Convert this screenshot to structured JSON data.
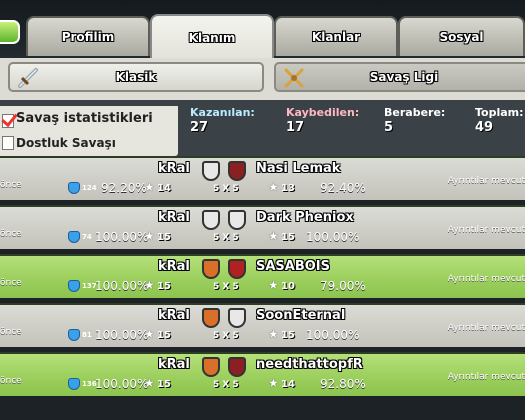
{
  "tabs": [
    {
      "label": "Profilim"
    },
    {
      "label": "Klanım"
    },
    {
      "label": "Klanlar"
    },
    {
      "label": "Sosyal"
    }
  ],
  "modes": {
    "classic": "Klasik",
    "league": "Savaş Ligi"
  },
  "stats": {
    "title": "Savaş istatistikleri",
    "friendly": "Dostluk Savaşı",
    "won_label": "Kazanılan:",
    "won": "27",
    "lost_label": "Kaybedilen:",
    "lost": "17",
    "draw_label": "Berabere:",
    "draw": "5",
    "total_label": "Toplam:",
    "total": "49"
  },
  "colors": {
    "win_row": "#9ed160",
    "draw_row": "#cfcfc8",
    "won_label": "#b9ecff",
    "lost_label": "#ffb8c0",
    "draw_label": "#ffffff",
    "total_label": "#ffffff"
  },
  "wars": [
    {
      "result": "draw",
      "ago": "önce",
      "our_clan": "kRal",
      "our_level": "124",
      "our_pct": "92.20%",
      "our_stars": "14",
      "size": "5 X 5",
      "enemy_clan": "Nasi Lemak",
      "enemy_stars": "13",
      "enemy_pct": "92.40%",
      "details": "Ayrıntılar mevcut"
    },
    {
      "result": "draw",
      "ago": "önce",
      "our_clan": "kRal",
      "our_level": "74",
      "our_pct": "100.00%",
      "our_stars": "15",
      "size": "5 X 5",
      "enemy_clan": "Dark Pheniox",
      "enemy_stars": "15",
      "enemy_pct": "100.00%",
      "details": "Ayrıntılar mevcut"
    },
    {
      "result": "win",
      "ago": "önce",
      "our_clan": "kRal",
      "our_level": "137",
      "our_pct": "100.00%",
      "our_stars": "15",
      "size": "5 X 5",
      "enemy_clan": "SASABOIS",
      "enemy_stars": "10",
      "enemy_pct": "79.00%",
      "details": "Ayrıntılar mevcut"
    },
    {
      "result": "draw",
      "ago": "önce",
      "our_clan": "kRal",
      "our_level": "81",
      "our_pct": "100.00%",
      "our_stars": "15",
      "size": "5 X 5",
      "enemy_clan": "SoonEternal",
      "enemy_stars": "15",
      "enemy_pct": "100.00%",
      "details": "Ayrıntılar mevcut"
    },
    {
      "result": "win",
      "ago": "önce",
      "our_clan": "kRal",
      "our_level": "136",
      "our_pct": "100.00%",
      "our_stars": "15",
      "size": "5 X 5",
      "enemy_clan": "needthattopfR",
      "enemy_stars": "14",
      "enemy_pct": "92.80%",
      "details": "Ayrıntılar mevcut"
    }
  ]
}
